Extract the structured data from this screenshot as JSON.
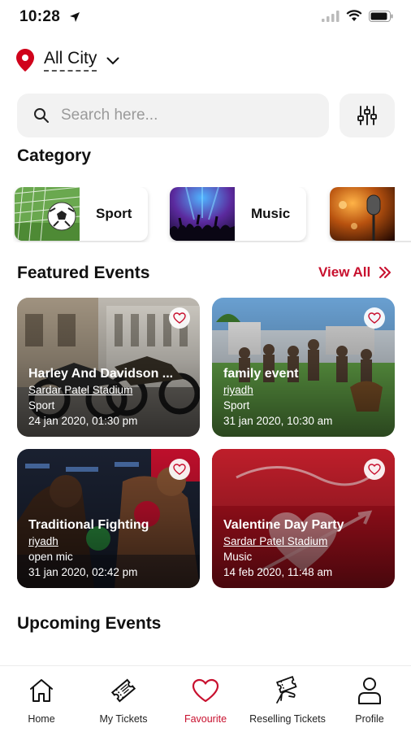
{
  "status_bar": {
    "time": "10:28"
  },
  "location": {
    "city": "All City"
  },
  "search": {
    "placeholder": "Search here..."
  },
  "category_section": {
    "title": "Category",
    "items": [
      {
        "label": "Sport",
        "icon": "soccer-ball-image"
      },
      {
        "label": "Music",
        "icon": "concert-image"
      },
      {
        "label": "",
        "icon": "microphone-image"
      }
    ]
  },
  "featured": {
    "title": "Featured Events",
    "view_all": "View All",
    "events": [
      {
        "title": "Harley And Davidson ...",
        "venue": "Sardar Patel Stadium",
        "category": "Sport",
        "datetime": "24 jan 2020, 01:30 pm"
      },
      {
        "title": "family event",
        "venue": "riyadh",
        "category": "Sport",
        "datetime": "31 jan 2020, 10:30 am"
      },
      {
        "title": "Traditional Fighting",
        "venue": "riyadh",
        "category": "open mic",
        "datetime": "31 jan 2020, 02:42 pm"
      },
      {
        "title": "Valentine Day Party",
        "venue": "Sardar Patel Stadium",
        "category": "Music",
        "datetime": "14 feb 2020, 11:48 am"
      }
    ]
  },
  "upcoming": {
    "title": "Upcoming Events"
  },
  "bottom_nav": {
    "items": [
      {
        "label": "Home",
        "icon": "home-icon"
      },
      {
        "label": "My Tickets",
        "icon": "ticket-icon"
      },
      {
        "label": "Favourite",
        "icon": "heart-icon",
        "active": true
      },
      {
        "label": "Reselling Tickets",
        "icon": "resell-ticket-icon"
      },
      {
        "label": "Profile",
        "icon": "profile-icon"
      }
    ]
  },
  "colors": {
    "accent": "#c8102e",
    "search_bg": "#f2f2f2"
  }
}
